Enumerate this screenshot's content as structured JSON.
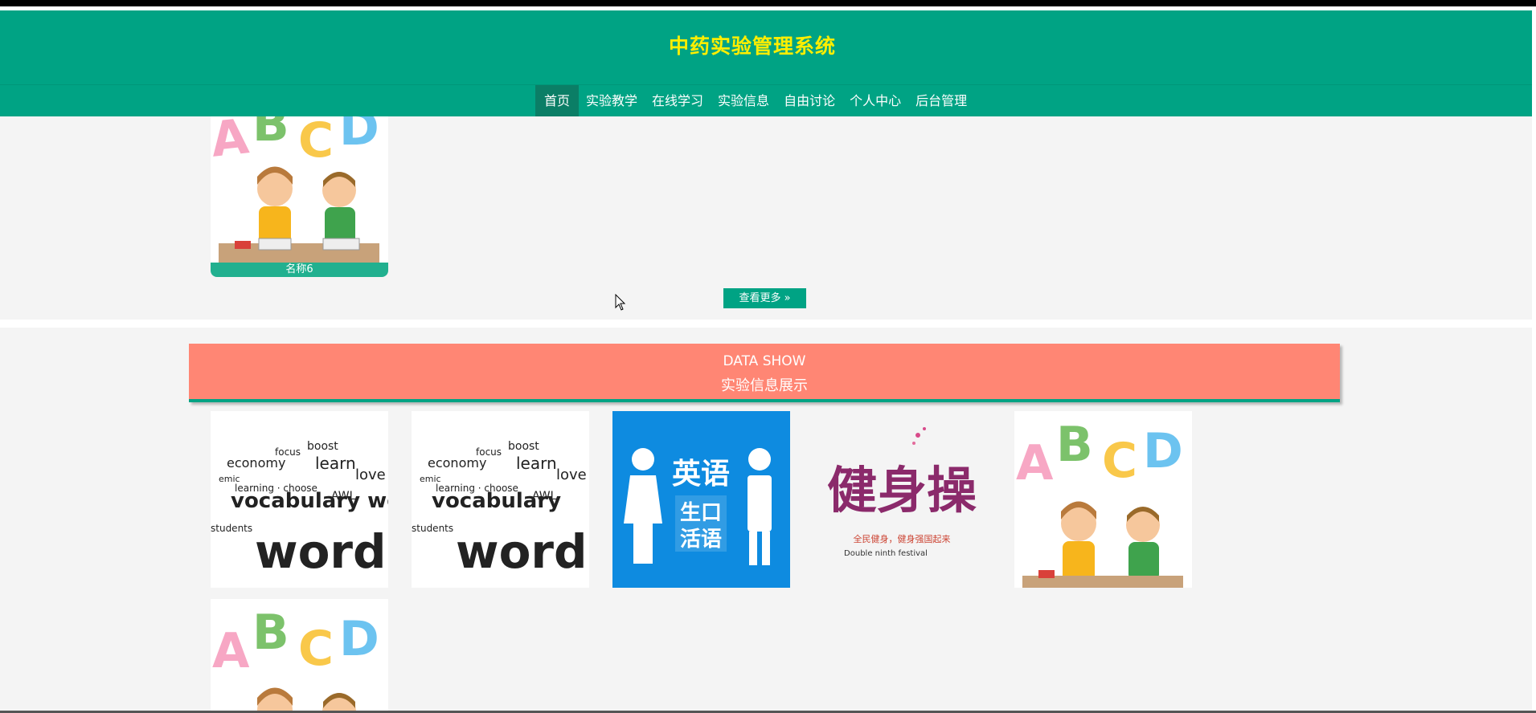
{
  "header": {
    "title": "中药实验管理系统",
    "nav": [
      {
        "label": "首页",
        "active": true
      },
      {
        "label": "实验教学"
      },
      {
        "label": "在线学习"
      },
      {
        "label": "实验信息"
      },
      {
        "label": "自由讨论"
      },
      {
        "label": "个人中心"
      },
      {
        "label": "后台管理"
      }
    ]
  },
  "upper": {
    "card_label": "名称6",
    "more_button": "查看更多 »"
  },
  "data_show": {
    "title_en": "DATA SHOW",
    "title_cn": "实验信息展示"
  },
  "thumbnails": {
    "words_image_text": "vocabulary words",
    "english_sign_text": [
      "英语",
      "生口",
      "活语"
    ],
    "festival_caption": "全民健身，健身强国起来",
    "festival_caption_en": "Double ninth festival",
    "calligraphy_text": "健身操"
  },
  "colors": {
    "primary": "#00a384",
    "title_yellow": "#ffee00",
    "banner_salmon": "#ff8674",
    "active_nav": "#0b7e66"
  }
}
